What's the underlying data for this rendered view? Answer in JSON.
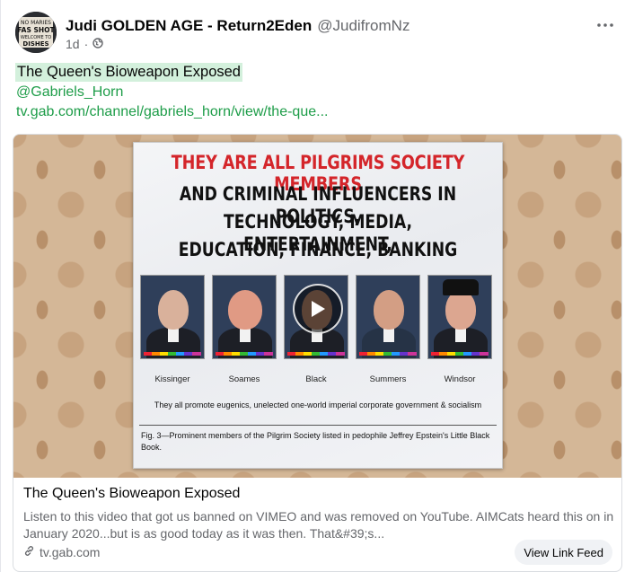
{
  "post": {
    "author_name": "Judi GOLDEN AGE - Return2Eden",
    "author_handle": "@JudifromNz",
    "timestamp": "1d",
    "separator": "·",
    "title": "The Queen's Bioweapon Exposed",
    "mention": "@Gabriels_Horn",
    "link_text": "tv.gab.com/channel/gabriels_horn/view/the-que..."
  },
  "avatar_text": [
    "NO MARIES",
    "FAS SHOT",
    "WELCOME TO",
    "DISHES"
  ],
  "card": {
    "title": "The Queen's Bioweapon Exposed",
    "description": "Listen to this video that got us banned on VIMEO and was removed on YouTube. AIMCats heard this on in January 2020...but is as good today as it was then.  That&#39;s...",
    "domain": "tv.gab.com",
    "feed_button": "View Link Feed"
  },
  "poster": {
    "headline_red": "THEY ARE ALL PILGRIMS SOCIETY MEMBERS",
    "headline_lines": [
      "AND CRIMINAL INFLUENCERS IN POLITICS,",
      "TECHNOLOGY, MEDIA, ENTERTAINMENT,",
      "EDUCATION, FINANCE, BANKING"
    ],
    "names": [
      "Kissinger",
      "Soames",
      "Black",
      "Summers",
      "Windsor"
    ],
    "note": "They all promote eugenics, unelected one-world imperial corporate government & socialism",
    "figure_caption": "Fig. 3—Prominent members of the Pilgrim Society listed in pedophile Jeffrey Epstein's Little Black Book."
  },
  "icons": {
    "privacy": "globe-icon",
    "more": "more-options-icon",
    "play": "play-icon",
    "link": "link-icon"
  },
  "colors": {
    "highlight": "#d3f0dc",
    "link_green": "#1e9d49",
    "poster_red": "#d4252a"
  }
}
